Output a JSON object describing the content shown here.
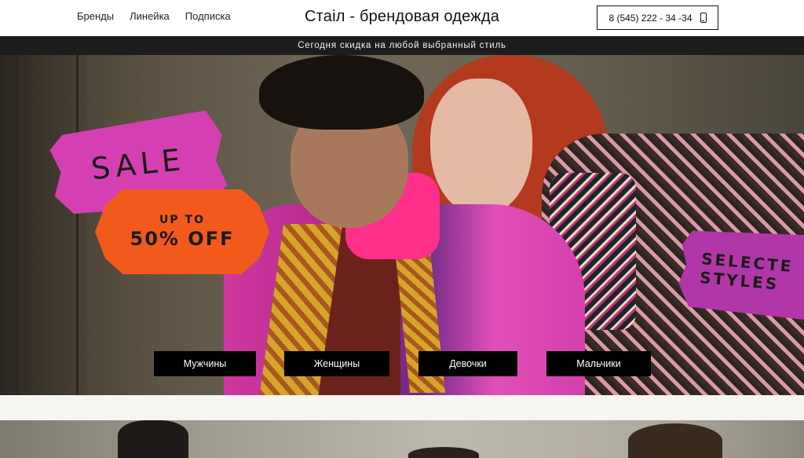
{
  "nav": {
    "items": [
      "Бренды",
      "Линейка",
      "Подписка"
    ]
  },
  "site_title": "Стаіл - брендовая одежда",
  "phone": {
    "number": "8 (545) 222 - 34 -34",
    "icon": "mobile-phone-icon"
  },
  "promo_bar": {
    "text": "Сегодня скидка на любой выбранный стиль"
  },
  "hero": {
    "stickers": {
      "sale": "SALE",
      "offer_line1": "UP TO",
      "offer_line2": "50% OFF",
      "selected_line1": "SELECTE",
      "selected_line2": "STYLES"
    },
    "categories": [
      "Мужчины",
      "Женщины",
      "Девочки",
      "Мальчики"
    ]
  },
  "colors": {
    "promo_bar_bg": "#1d1d1d",
    "button_bg": "#000000",
    "sticker_pink": "#d440b2",
    "sticker_orange": "#f25a1c",
    "sticker_purple": "#b136a8"
  }
}
